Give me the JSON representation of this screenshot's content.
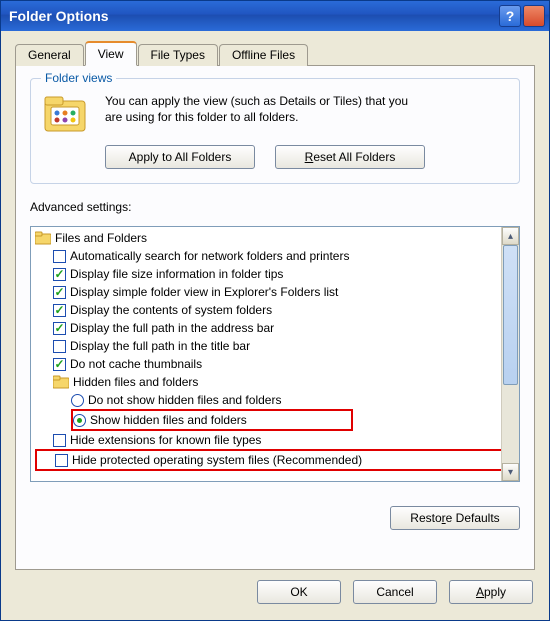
{
  "title": "Folder Options",
  "tabs": {
    "general": "General",
    "view": "View",
    "filetypes": "File Types",
    "offline": "Offline Files"
  },
  "folderviews": {
    "legend": "Folder views",
    "desc_line1": "You can apply the view (such as Details or Tiles) that you",
    "desc_line2": "are using for this folder to all folders.",
    "apply_all": "Apply to All Folders",
    "reset_all": "Reset All Folders"
  },
  "adv_label": "Advanced settings:",
  "tree": {
    "root": "Files and Folders",
    "i1": "Automatically search for network folders and printers",
    "i2": "Display file size information in folder tips",
    "i3": "Display simple folder view in Explorer's Folders list",
    "i4": "Display the contents of system folders",
    "i5": "Display the full path in the address bar",
    "i6": "Display the full path in the title bar",
    "i7": "Do not cache thumbnails",
    "hidden_group": "Hidden files and folders",
    "r1": "Do not show hidden files and folders",
    "r2": "Show hidden files and folders",
    "i8": "Hide extensions for known file types",
    "i9": "Hide protected operating system files (Recommended)"
  },
  "restore": "Restore Defaults",
  "buttons": {
    "ok": "OK",
    "cancel": "Cancel",
    "apply": "Apply"
  }
}
